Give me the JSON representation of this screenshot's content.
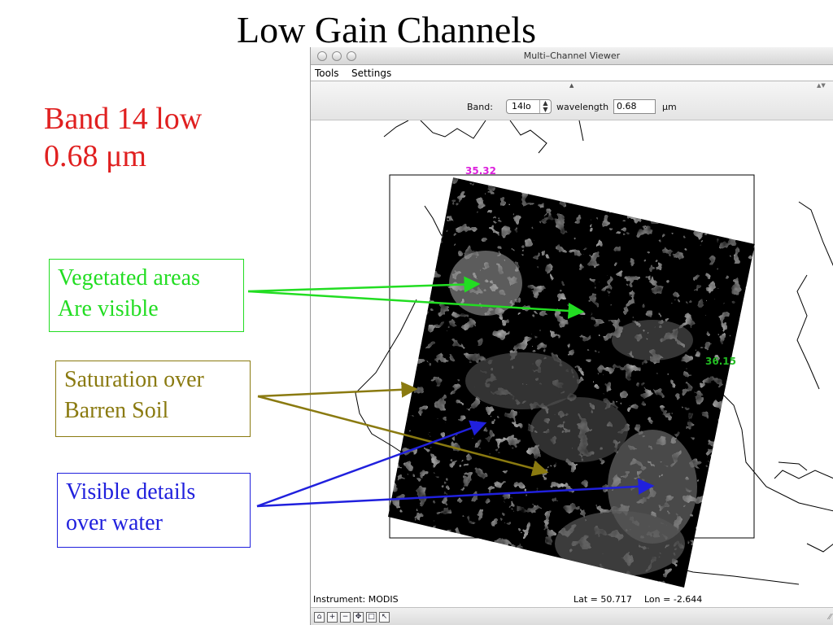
{
  "slide": {
    "title": "Low Gain Channels",
    "band_line1": "Band 14 low",
    "band_line2": "0.68 μm",
    "notes": {
      "vegetated_line1": "Vegetated areas",
      "vegetated_line2": "Are visible",
      "saturation_line1": "Saturation over",
      "saturation_line2": "Barren Soil",
      "water_line1": "Visible details",
      "water_line2": "over water"
    },
    "colors": {
      "band": "#e02020",
      "vegetated": "#22dd22",
      "saturation": "#8a7a10",
      "water": "#2020dd"
    }
  },
  "viewer": {
    "window_title": "Multi–Channel Viewer",
    "menu": {
      "tools": "Tools",
      "settings": "Settings"
    },
    "toolbar": {
      "band_label": "Band:",
      "band_value": "14lo",
      "wavelength_label": "wavelength",
      "wavelength_value": "0.68",
      "unit": "μm"
    },
    "map_labels": {
      "corner_top": "35.32",
      "corner_right": "36.15"
    },
    "status": {
      "instrument": "Instrument: MODIS",
      "lat": "Lat = 50.717",
      "lon": "Lon = -2.644"
    },
    "tool_icons": [
      "home-icon",
      "zoom-in-icon",
      "zoom-out-icon",
      "pan-icon",
      "select-box-icon",
      "pointer-icon"
    ]
  }
}
